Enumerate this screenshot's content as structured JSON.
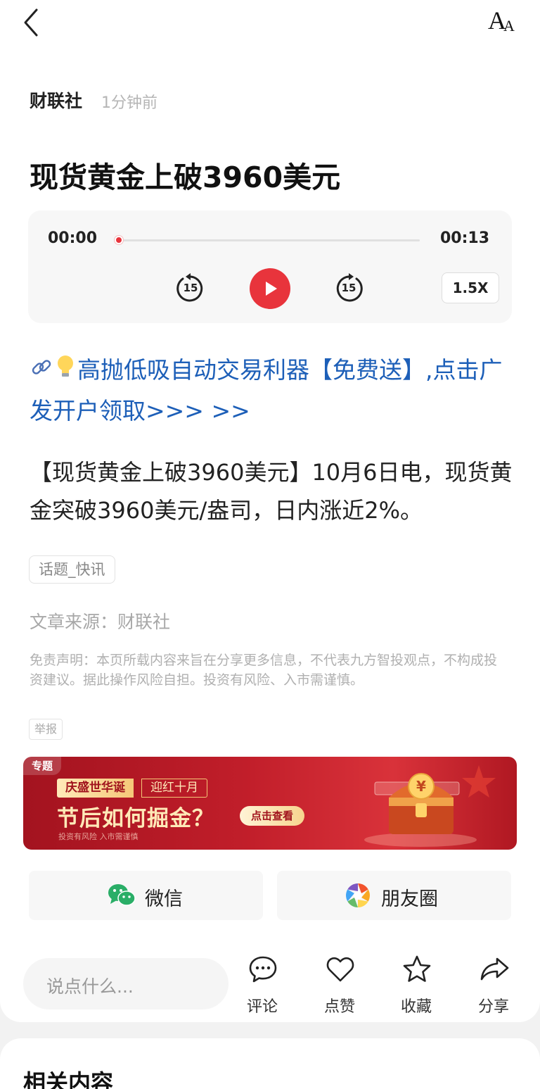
{
  "header": {
    "back_icon": "chevron-left-icon",
    "font_size_icon_big": "A",
    "font_size_icon_small": "A"
  },
  "article": {
    "source": "财联社",
    "time": "1分钟前",
    "title": "现货黄金上破3960美元"
  },
  "player": {
    "current_time": "00:00",
    "total_time": "00:13",
    "rewind_seconds": "15",
    "forward_seconds": "15",
    "speed": "1.5X",
    "progress_fraction": 0,
    "accent": "#e8343c"
  },
  "promo": {
    "text": "高抛低吸自动交易利器【免费送】,点击广发开户领取>>> >>",
    "color": "#1d5fb8"
  },
  "body": {
    "text": "【现货黄金上破3960美元】10月6日电，现货黄金突破3960美元/盎司，日内涨近2%。"
  },
  "tag": "话题_快讯",
  "article_source": "文章来源：财联社",
  "disclaimer": "免责声明：本页所载内容来旨在分享更多信息，不代表九方智投观点，不构成投资建议。据此操作风险自担。投资有风险、入市需谨慎。",
  "report": "举报",
  "banner": {
    "corner": "专题",
    "pill1": "庆盛世华诞",
    "pill2": "迎红十月",
    "headline": "节后如何掘金？",
    "cta": "点击查看",
    "risk": "投资有风险  入市需谨慎"
  },
  "share": {
    "wechat": "微信",
    "moments": "朋友圈"
  },
  "bottom_bar": {
    "comment_placeholder": "说点什么...",
    "comment_label": "评论",
    "like_label": "点赞",
    "favorite_label": "收藏",
    "share_label": "分享"
  },
  "related": {
    "title": "相关内容"
  }
}
